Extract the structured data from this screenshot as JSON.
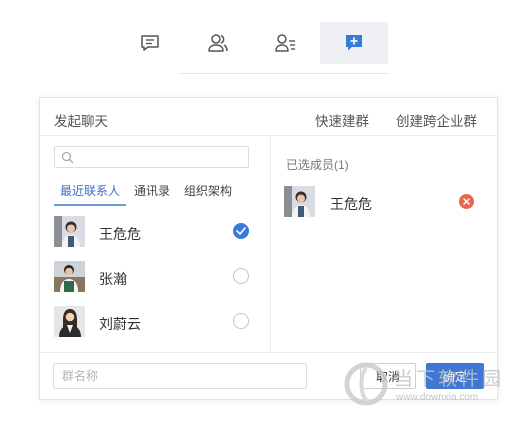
{
  "toolbar": {
    "items": [
      {
        "icon": "chat-icon",
        "active": false
      },
      {
        "icon": "contacts-icon",
        "active": false
      },
      {
        "icon": "contact-card-icon",
        "active": false
      },
      {
        "icon": "add-chat-icon",
        "active": true
      }
    ],
    "accent": "#3a7bd8"
  },
  "dialog": {
    "title": "发起聊天",
    "quick_group": "快速建群",
    "cross_group": "创建跨企业群",
    "search": {
      "placeholder": "",
      "value": ""
    },
    "tabs": [
      "最近联系人",
      "通讯录",
      "组织架构"
    ],
    "contacts": [
      {
        "name": "王危危",
        "checked": true
      },
      {
        "name": "张瀚",
        "checked": false
      },
      {
        "name": "刘蔚云",
        "checked": false
      }
    ],
    "selected": {
      "title": "已选成员(1)",
      "members": [
        {
          "name": "王危危"
        }
      ]
    },
    "footer": {
      "group_name_placeholder": "群名称",
      "cancel": "取消",
      "ok": "确定"
    }
  },
  "watermark": {
    "text": "当下软件园",
    "url": "www.downxia.com"
  },
  "colors": {
    "primary": "#3f77d3",
    "danger": "#e9654c",
    "tab_active": "#3e6fc4"
  }
}
